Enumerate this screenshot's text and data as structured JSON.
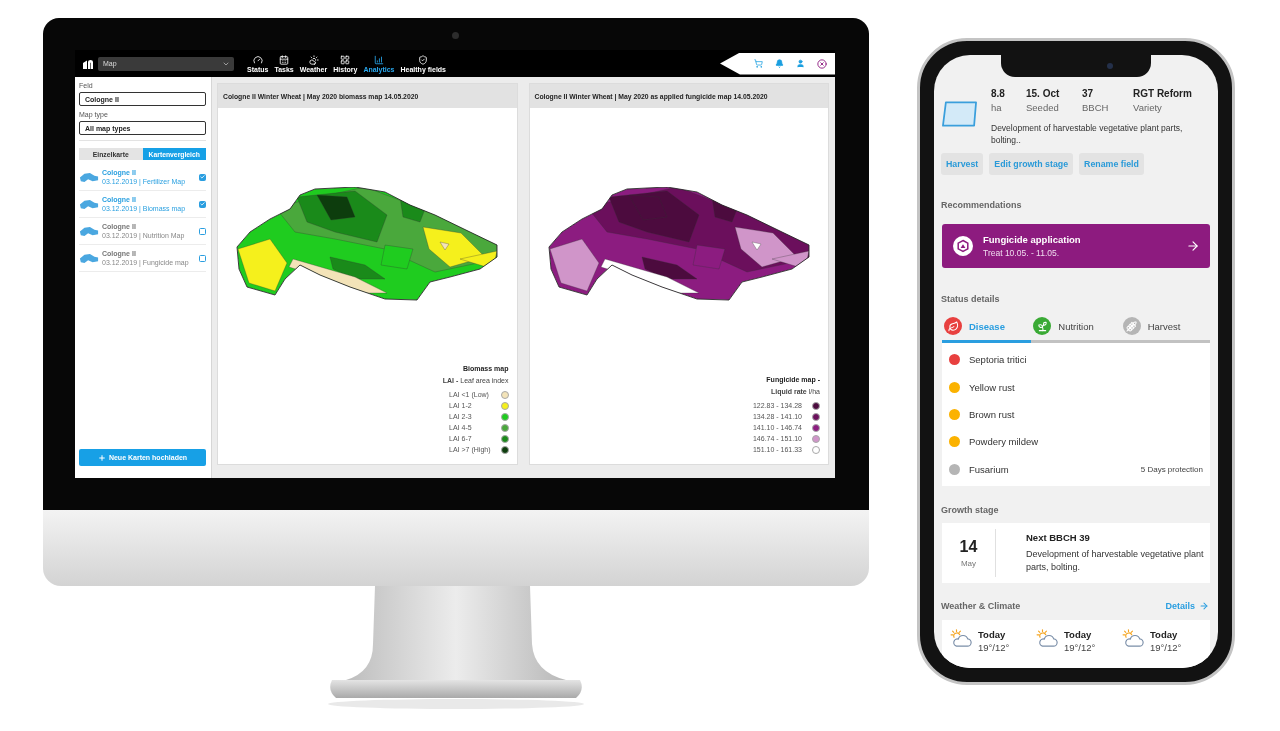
{
  "desktop": {
    "top_bar": {
      "map_select": {
        "value": "Map"
      },
      "nav": [
        {
          "label": "Status",
          "selected": false
        },
        {
          "label": "Tasks",
          "selected": false
        },
        {
          "label": "Weather",
          "selected": false
        },
        {
          "label": "History",
          "selected": false
        },
        {
          "label": "Analytics",
          "selected": true
        },
        {
          "label": "Healthy fields",
          "selected": false
        }
      ]
    },
    "sidebar": {
      "field": {
        "label": "Feld",
        "value": "Cologne II"
      },
      "map_type": {
        "label": "Map type",
        "value": "All map types"
      },
      "view_toggle": [
        {
          "label": "Einzelkarte",
          "selected": false
        },
        {
          "label": "Kartenvergleich",
          "selected": true
        }
      ],
      "maps": [
        {
          "title": "Cologne II",
          "subtitle": "03.12.2019 | Fertilizer Map",
          "checked": true
        },
        {
          "title": "Cologne II",
          "subtitle": "03.12.2019 | Biomass map",
          "checked": true
        },
        {
          "title": "Cologne II",
          "subtitle": "03.12.2019 | Nutrition Map",
          "checked": false
        },
        {
          "title": "Cologne II",
          "subtitle": "03.12.2019 | Fungicide map",
          "checked": false
        }
      ],
      "upload_button": "Neue Karten hochladen"
    },
    "panels": [
      {
        "kind": "biomass",
        "title": "Cologne II Winter Wheat | May 2020 biomass map 14.05.2020",
        "legend": {
          "title": "Biomass map",
          "subtitle": "**LAI -** Leaf area index",
          "items": [
            {
              "label": "LAI <1 (Low)",
              "color": "#f3e3b8"
            },
            {
              "label": "LAI 1-2",
              "color": "#f5f01c"
            },
            {
              "label": "LAI 2-3",
              "color": "#1fcc1f"
            },
            {
              "label": "LAI 4-5",
              "color": "#4aa83c"
            },
            {
              "label": "LAI 6-7",
              "color": "#1a8a1a"
            },
            {
              "label": "LAI >7 (High)",
              "color": "#0d3d0d"
            }
          ]
        }
      },
      {
        "kind": "fungicide",
        "title": "Cologne II Winter Wheat | May 2020 as applied fungicide map 14.05.2020",
        "legend": {
          "title": "Fungicide map -",
          "subtitle": "**Liquid rate** l/ha",
          "items": [
            {
              "label": "122.83 - 134.28",
              "color": "#4c0b3e"
            },
            {
              "label": "134.28 - 141.10",
              "color": "#6b0f5c"
            },
            {
              "label": "141.10 - 146.74",
              "color": "#8c1c80"
            },
            {
              "label": "146.74 - 151.10",
              "color": "#d095c9"
            },
            {
              "label": "151.10 - 161.33",
              "color": "#ffffff"
            }
          ]
        }
      }
    ]
  },
  "phone": {
    "field": {
      "stats": [
        {
          "value": "8.8",
          "label": "ha"
        },
        {
          "value": "15. Oct",
          "label": "Seeded"
        },
        {
          "value": "37",
          "label": "BBCH"
        },
        {
          "value": "RGT Reform",
          "label": "Variety"
        }
      ],
      "description": "Development of harvestable vegetative plant parts, bolting.."
    },
    "actions": [
      "Harvest",
      "Edit growth stage",
      "Rename field"
    ],
    "recommendations": {
      "heading": "Recommendations",
      "card": {
        "title": "Fungicide application",
        "subtitle": "Treat 10.05. - 11.05."
      }
    },
    "status_details": {
      "heading": "Status details",
      "tabs": [
        {
          "label": "Disease",
          "selected": true,
          "color": "#e8403f"
        },
        {
          "label": "Nutrition",
          "selected": false,
          "color": "#3aaa35"
        },
        {
          "label": "Harvest",
          "selected": false,
          "color": "#b5b5b5"
        }
      ],
      "items": [
        {
          "name": "Septoria tritici",
          "color": "#e8403f"
        },
        {
          "name": "Yellow rust",
          "color": "#fbb200"
        },
        {
          "name": "Brown rust",
          "color": "#fbb200"
        },
        {
          "name": "Powdery mildew",
          "color": "#fbb200"
        },
        {
          "name": "Fusarium",
          "color": "#b5b5b5",
          "note": "5 Days protection"
        }
      ]
    },
    "growth_stage": {
      "heading": "Growth stage",
      "day": "14",
      "month": "May",
      "title": "Next BBCH 39",
      "text": "Development of harvestable vegetative plant parts, bolting."
    },
    "weather": {
      "heading": "Weather & Climate",
      "details_link": "Details",
      "days": [
        {
          "day": "Today",
          "temps": "19°/12°"
        },
        {
          "day": "Today",
          "temps": "19°/12°"
        },
        {
          "day": "Today",
          "temps": "19°/12°"
        }
      ]
    }
  }
}
